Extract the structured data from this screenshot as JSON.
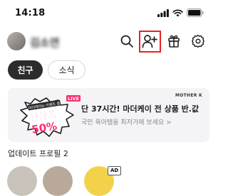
{
  "status_bar": {
    "time": "14:18"
  },
  "header": {
    "username": "김소연",
    "icons": [
      "search-icon",
      "add-friend-icon",
      "gift-box-icon",
      "settings-gear-icon"
    ],
    "highlight_color": "#e52424"
  },
  "tabs": {
    "friends": "친구",
    "news": "소식"
  },
  "banner": {
    "live_badge": "LIVE",
    "art_text_top": "마더케이는 이벤트 중",
    "art_text_main": "전상품",
    "art_text_percent": "50%",
    "brand": "MOTHER K",
    "title": "단 37시간! 마더케이 전 상품 반.값",
    "subtitle": "국민 육아템을 최저가에 보세요 >"
  },
  "section": {
    "updated_profiles": "업데이트 프로필 2"
  },
  "profiles_row": {
    "ad_badge": "AD"
  },
  "colors": {
    "accent_pink": "#ff2d6f",
    "chip_active_bg": "#2c2c2c",
    "banner_bg": "#f4f4f6"
  }
}
